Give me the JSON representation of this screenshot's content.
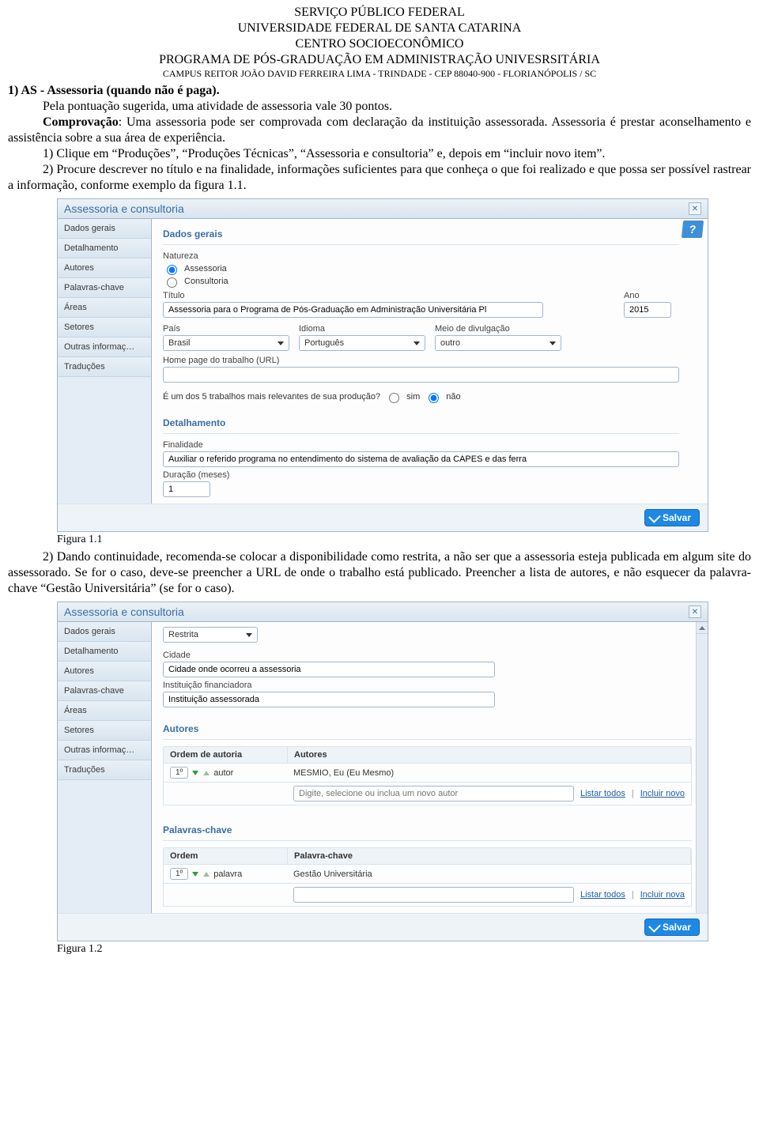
{
  "header": {
    "l1": "SERVIÇO PÚBLICO FEDERAL",
    "l2": "UNIVERSIDADE FEDERAL DE SANTA CATARINA",
    "l3": "CENTRO SOCIOECONÔMICO",
    "l4": "PROGRAMA DE PÓS-GRADUAÇÃO EM ADMINISTRAÇÃO UNIVESRSITÁRIA",
    "l5": "CAMPUS REITOR JOÃO DAVID FERREIRA LIMA - TRINDADE - CEP 88040-900 - FLORIANÓPOLIS / SC"
  },
  "text": {
    "s1_title": "1) AS - Assessoria (quando não é paga).",
    "s1_l1": "Pela pontuação sugerida, uma atividade de assessoria vale 30 pontos.",
    "s1_l2a": "Comprovação",
    "s1_l2b": ": Uma assessoria pode ser comprovada com declaração da instituição assessorada. Assessoria é prestar aconselhamento e assistência sobre a sua área de experiência.",
    "s1_l3": "1) Clique em “Produções”, “Produções Técnicas”, “Assessoria e consultoria” e, depois em “incluir novo item”.",
    "s1_l4": "2) Procure descrever no título e na finalidade, informações suficientes para que conheça o que foi realizado e que possa ser possível rastrear a informação, conforme exemplo da figura 1.1.",
    "fig1": "Figura 1.1",
    "s2": "2) Dando continuidade, recomenda-se colocar a disponibilidade como restrita, a não ser que a assessoria esteja publicada em algum site do assessorado. Se for o caso, deve-se preencher a URL de onde o trabalho está publicado. Preencher a lista de autores, e não esquecer da palavra-chave “Gestão Universitária” (se for o caso).",
    "fig2": "Figura 1.2"
  },
  "panel": {
    "title": "Assessoria e consultoria",
    "help": "?",
    "save": "Salvar",
    "sidebar": [
      "Dados gerais",
      "Detalhamento",
      "Autores",
      "Palavras-chave",
      "Áreas",
      "Setores",
      "Outras informaç…",
      "Traduções"
    ]
  },
  "fig1form": {
    "sec_dados": "Dados gerais",
    "natureza_label": "Natureza",
    "natureza_opt1": "Assessoria",
    "natureza_opt2": "Consultoria",
    "titulo_label": "Título",
    "titulo_val": "Assessoria para o Programa de Pós-Graduação em Administração Universitária Pl",
    "ano_label": "Ano",
    "ano_val": "2015",
    "pais_label": "País",
    "pais_val": "Brasil",
    "idioma_label": "Idioma",
    "idioma_val": "Português",
    "meio_label": "Meio de divulgação",
    "meio_val": "outro",
    "url_label": "Home page do trabalho (URL)",
    "url_val": "",
    "relev_q": "É um dos 5 trabalhos mais relevantes de sua produção?",
    "sim": "sim",
    "nao": "não",
    "sec_det": "Detalhamento",
    "finalidade_label": "Finalidade",
    "finalidade_val": "Auxiliar o referido programa no entendimento do sistema de avaliação da CAPES e das ferra",
    "duracao_label": "Duração (meses)",
    "duracao_val": "1"
  },
  "fig2form": {
    "restrita": "Restrita",
    "cidade_label": "Cidade",
    "cidade_val": "Cidade onde ocorreu a assessoria",
    "inst_label": "Instituição financiadora",
    "inst_val": "Instituição assessorada",
    "sec_autores": "Autores",
    "col_ordem": "Ordem de autoria",
    "col_autores": "Autores",
    "ord1": "1º",
    "autor_tag": "autor",
    "autor_name": "MESMIO, Eu (Eu Mesmo)",
    "placeholder": "Digite, selecione ou inclua um novo autor",
    "listar": "Listar todos",
    "incluir_novo": "Incluir novo",
    "incluir_nova": "Incluir nova",
    "sec_palavras": "Palavras-chave",
    "col_ordem2": "Ordem",
    "col_palavra": "Palavra-chave",
    "palavra_tag": "palavra",
    "palavra_val": "Gestão Universitária"
  }
}
